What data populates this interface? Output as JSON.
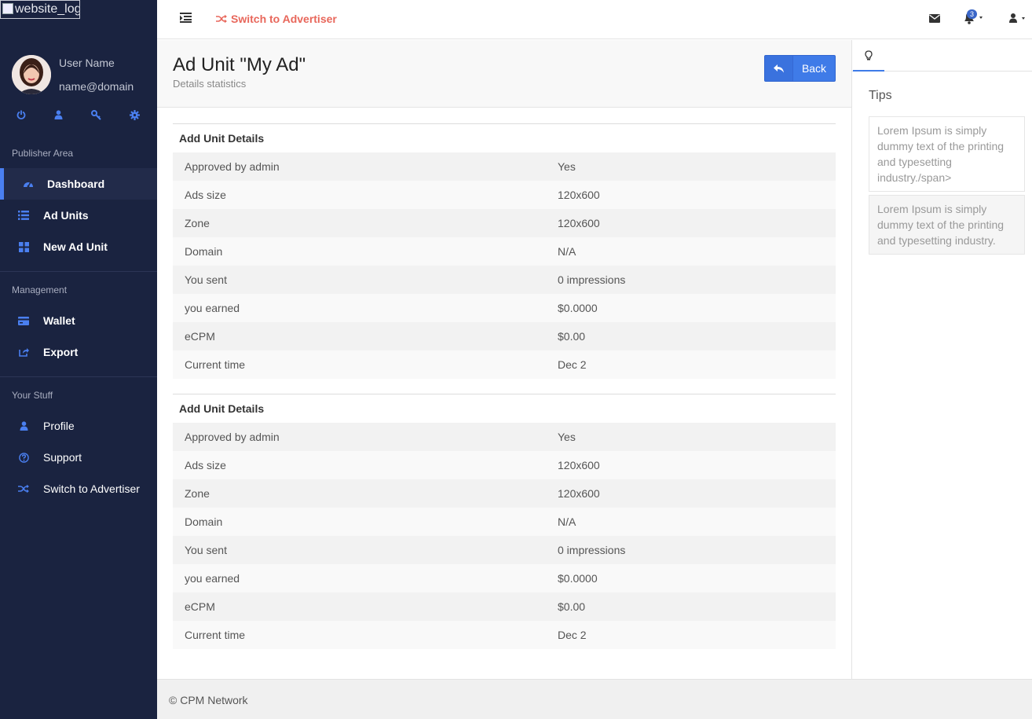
{
  "logo": {
    "alt": "website_logo"
  },
  "user": {
    "name": "User Name",
    "email": "name@domain"
  },
  "user_actions": [
    {
      "icon": "power-icon"
    },
    {
      "icon": "user-icon"
    },
    {
      "icon": "key-icon"
    },
    {
      "icon": "gear-icon"
    }
  ],
  "sidebar": {
    "sections": [
      {
        "heading": "Publisher Area",
        "items": [
          {
            "label": "Dashboard",
            "icon": "dashboard-icon",
            "active": true
          },
          {
            "label": "Ad Units",
            "icon": "list-icon"
          },
          {
            "label": "New Ad Unit",
            "icon": "grid-icon"
          }
        ]
      },
      {
        "heading": "Management",
        "items": [
          {
            "label": "Wallet",
            "icon": "credit-card-icon"
          },
          {
            "label": "Export",
            "icon": "share-icon"
          }
        ]
      },
      {
        "heading": "Your Stuff",
        "items": [
          {
            "label": "Profile",
            "icon": "user-icon"
          },
          {
            "label": "Support",
            "icon": "question-icon"
          },
          {
            "label": "Switch to Advertiser",
            "icon": "shuffle-icon"
          }
        ]
      }
    ]
  },
  "topbar": {
    "switch_label": "Switch to Advertiser",
    "notifications_count": "3",
    "accent_color": "#e8675b"
  },
  "page": {
    "title": "Ad Unit \"My Ad\"",
    "subtitle": "Details statistics",
    "back_label": "Back"
  },
  "panels": [
    {
      "heading": "Add Unit Details",
      "rows": [
        {
          "key": "Approved by admin",
          "value": "Yes"
        },
        {
          "key": "Ads size",
          "value": "120x600"
        },
        {
          "key": "Zone",
          "value": "120x600"
        },
        {
          "key": "Domain",
          "value": "N/A"
        },
        {
          "key": "You sent",
          "value": "0 impressions"
        },
        {
          "key": "you earned",
          "value": "$0.0000"
        },
        {
          "key": "eCPM",
          "value": "$0.00"
        },
        {
          "key": "Current time",
          "value": "Dec 2"
        }
      ]
    },
    {
      "heading": "Add Unit Details",
      "rows": [
        {
          "key": "Approved by admin",
          "value": "Yes"
        },
        {
          "key": "Ads size",
          "value": "120x600"
        },
        {
          "key": "Zone",
          "value": "120x600"
        },
        {
          "key": "Domain",
          "value": "N/A"
        },
        {
          "key": "You sent",
          "value": "0 impressions"
        },
        {
          "key": "you earned",
          "value": "$0.0000"
        },
        {
          "key": "eCPM",
          "value": "$0.00"
        },
        {
          "key": "Current time",
          "value": "Dec 2"
        }
      ]
    }
  ],
  "tips": {
    "title": "Tips",
    "items": [
      "Lorem Ipsum is simply dummy text of the printing and typesetting industry./span>",
      "Lorem Ipsum is simply dummy text of the printing and typesetting industry."
    ]
  },
  "footer": {
    "text": "© CPM Network"
  },
  "colors": {
    "sidebar_bg": "#1a2340",
    "primary": "#3f7be8",
    "icon_blue": "#4a7ff0"
  }
}
